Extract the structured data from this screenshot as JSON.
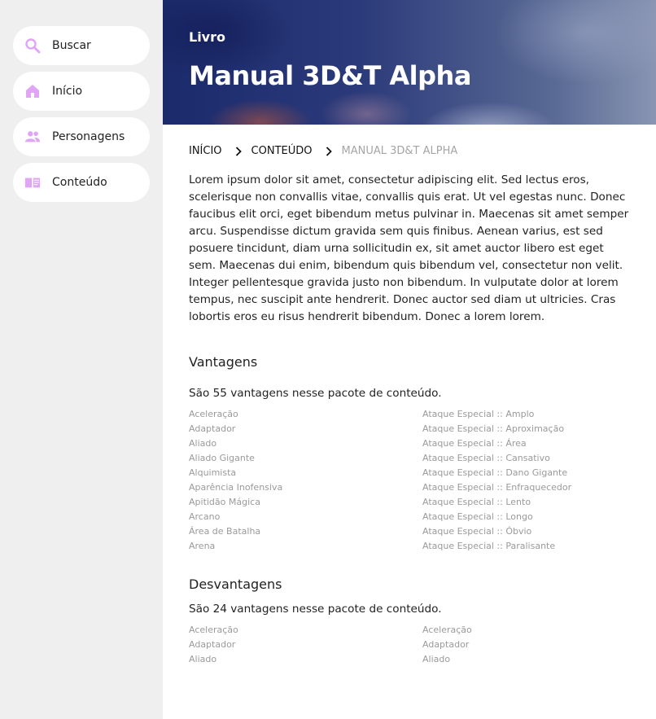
{
  "sidebar": {
    "items": [
      {
        "label": "Buscar",
        "icon": "search-icon"
      },
      {
        "label": "Início",
        "icon": "home-icon"
      },
      {
        "label": "Personagens",
        "icon": "people-icon"
      },
      {
        "label": "Conteúdo",
        "icon": "book-icon"
      }
    ],
    "accent_color": "#e0a6f5"
  },
  "hero": {
    "kicker": "Livro",
    "title": "Manual 3D&T Alpha"
  },
  "breadcrumb": [
    "INÍCIO",
    "CONTEÚDO",
    "MANUAL 3D&T ALPHA"
  ],
  "intro": "Lorem ipsum dolor sit amet, consectetur adipiscing elit. Sed lectus eros, scelerisque non convallis vitae, convallis quis erat. Ut vel egestas nunc. Donec faucibus elit orci, eget bibendum metus pulvinar in. Maecenas sit amet semper arcu. Suspendisse dictum gravida sem quis finibus. Aenean varius, est sed posuere tincidunt, diam urna sollicitudin ex, sit amet auctor libero est eget sem. Maecenas dui enim, bibendum quis bibendum vel, consectetur non velit. Integer pellentesque gravida justo non bibendum. In vulputate dolor at lorem tempus, nec suscipit ante hendrerit. Donec auctor sed diam ut ultricies. Cras lobortis eros eu risus hendrerit bibendum. Donec a lorem lorem.",
  "vantagens": {
    "title": "Vantagens",
    "count_text": "São 55 vantagens nesse pacote de conteúdo.",
    "col1": [
      "Aceleração",
      "Adaptador",
      "Aliado",
      "Aliado Gigante",
      "Alquimista",
      "Aparência Inofensiva",
      "Apitidão Mágica",
      "Arcano",
      "Área de Batalha",
      "Arena"
    ],
    "col2": [
      "Ataque Especial :: Amplo",
      "Ataque Especial :: Aproximação",
      "Ataque Especial :: Área",
      "Ataque Especial :: Cansativo",
      "Ataque Especial :: Dano Gigante",
      "Ataque Especial :: Enfraquecedor",
      "Ataque Especial :: Lento",
      "Ataque Especial :: Longo",
      "Ataque Especial :: Óbvio",
      "Ataque Especial :: Paralisante"
    ]
  },
  "desvantagens": {
    "title": "Desvantagens",
    "count_text": "São 24 vantagens nesse pacote de conteúdo.",
    "col1": [
      "Aceleração",
      "Adaptador",
      "Aliado"
    ],
    "col2": [
      "Aceleração",
      "Adaptador",
      "Aliado"
    ]
  }
}
